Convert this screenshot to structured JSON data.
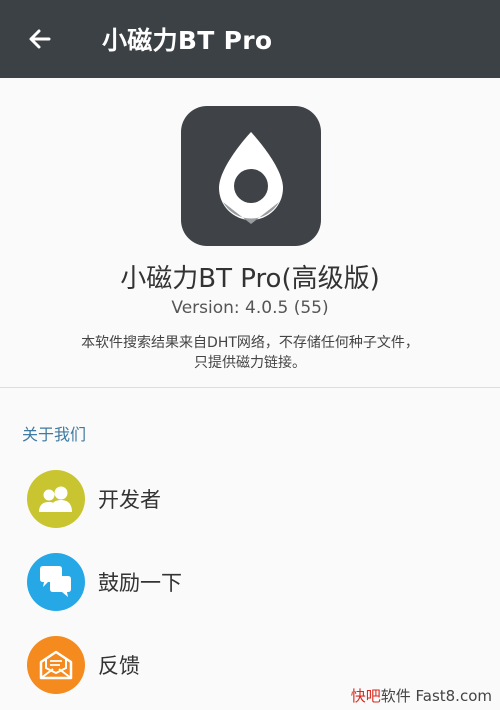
{
  "toolbar": {
    "title": "小磁力BT Pro",
    "back_icon": "arrow-left-icon"
  },
  "app": {
    "icon": "location-pin-icon",
    "name": "小磁力BT Pro(高级版)",
    "version": "Version: 4.0.5 (55)",
    "description_line1": "本软件搜索结果来自DHT网络，不存储任何种子文件，",
    "description_line2": "只提供磁力链接。"
  },
  "section": {
    "header": "关于我们"
  },
  "items": [
    {
      "label": "开发者",
      "icon": "people-icon",
      "color": "#c8c530"
    },
    {
      "label": "鼓励一下",
      "icon": "chat-bubbles-icon",
      "color": "#26a8e6"
    },
    {
      "label": "反馈",
      "icon": "envelope-icon",
      "color": "#f58a1f"
    }
  ],
  "watermark": {
    "part1": "快吧",
    "part2": "软件 Fast8.com"
  }
}
